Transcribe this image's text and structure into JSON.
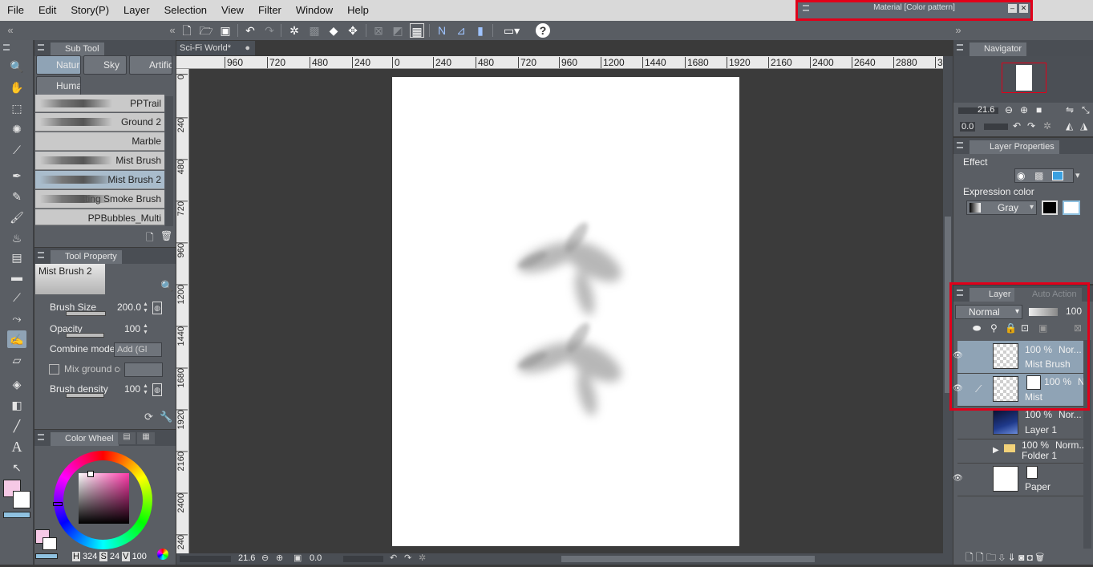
{
  "menubar": {
    "items": [
      "File",
      "Edit",
      "Story(P)",
      "Layer",
      "Selection",
      "View",
      "Filter",
      "Window",
      "Help"
    ]
  },
  "material_window": {
    "title": "Material [Color pattern]"
  },
  "sub_tool": {
    "tab_label": "Sub Tool",
    "groups": [
      "Natur",
      "Sky",
      "Artific",
      "Huma"
    ],
    "brushes": [
      "PPTrail",
      "Ground 2",
      "Marble",
      "Mist Brush",
      "Mist Brush 2",
      "Twisting Smoke Brush",
      "PPBubbles_Multi"
    ],
    "selected_brush": "Mist Brush 2"
  },
  "tool_property": {
    "tab_label": "Tool Property",
    "tool_name": "Mist Brush 2",
    "brush_size_label": "Brush Size",
    "brush_size_value": "200.0",
    "opacity_label": "Opacity",
    "opacity_value": "100",
    "combine_mode_label": "Combine mode",
    "combine_mode_value": "Add (Gl",
    "mix_ground_label": "Mix ground co",
    "brush_density_label": "Brush density",
    "brush_density_value": "100"
  },
  "color_wheel": {
    "tab_label": "Color Wheel",
    "h_label": "H",
    "h_value": "324",
    "s_label": "S",
    "s_value": "24",
    "v_label": "V",
    "v_value": "100",
    "main_color": "#f6c9e6",
    "sub_color": "#ffffff"
  },
  "document": {
    "tab_label": "Sci-Fi World*",
    "h_ruler": [
      "960",
      "720",
      "480",
      "240",
      "0",
      "240",
      "480",
      "720",
      "960",
      "1200",
      "1440",
      "1680",
      "1920",
      "2160",
      "2400",
      "2640",
      "2880",
      "3"
    ],
    "v_ruler": [
      "0",
      "240",
      "480",
      "720",
      "960",
      "1200",
      "1440",
      "1680",
      "1920",
      "2160",
      "2400",
      "240"
    ],
    "zoom": "21.6",
    "rotation": "0.0"
  },
  "navigator": {
    "tab_label": "Navigator",
    "zoom": "21.6",
    "rotation": "0.0"
  },
  "layer_properties": {
    "tab_label": "Layer Properties",
    "effect_label": "Effect",
    "expression_color_label": "Expression color",
    "expression_color_value": "Gray"
  },
  "layer_panel": {
    "tab_label": "Layer",
    "tab2_label": "Auto Action",
    "blend_mode": "Normal",
    "opacity": "100",
    "layers": [
      {
        "opacity": "100 %",
        "mode": "Nor...",
        "name": "Mist Brush"
      },
      {
        "opacity": "100 %",
        "mode": "N",
        "name": "Mist"
      },
      {
        "opacity": "100 %",
        "mode": "Nor...",
        "name": "Layer 1"
      },
      {
        "opacity": "100 %",
        "mode": "Norm...",
        "name": "Folder 1"
      },
      {
        "opacity": "",
        "mode": "",
        "name": "Paper"
      }
    ]
  },
  "colors": {
    "highlight": "#e0001a",
    "selection": "#8fa3b5"
  }
}
